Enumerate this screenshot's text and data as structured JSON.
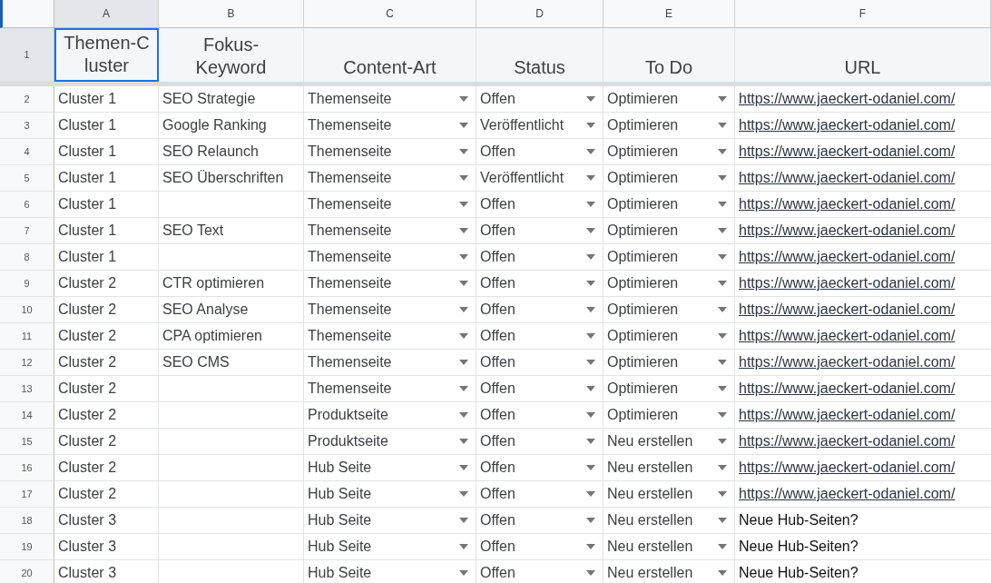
{
  "columns": [
    {
      "letter": "A",
      "selected": true
    },
    {
      "letter": "B",
      "selected": false
    },
    {
      "letter": "C",
      "selected": false
    },
    {
      "letter": "D",
      "selected": false
    },
    {
      "letter": "E",
      "selected": false
    },
    {
      "letter": "F",
      "selected": false
    }
  ],
  "header_row": {
    "number": "1",
    "selected": true,
    "cells": [
      {
        "label": "Themen-C\nluster",
        "selected": true
      },
      {
        "label": "Fokus-\nKeyword",
        "selected": false
      },
      {
        "label": "Content-Art",
        "selected": false
      },
      {
        "label": "Status",
        "selected": false
      },
      {
        "label": "To Do",
        "selected": false
      },
      {
        "label": "URL",
        "selected": false
      }
    ]
  },
  "rows": [
    {
      "number": "2",
      "cluster": "Cluster 1",
      "keyword": "SEO Strategie",
      "content_type": "Themenseite",
      "status": "Offen",
      "todo": "Optimieren",
      "url": {
        "kind": "link",
        "text": "https://www.jaeckert-odaniel.com/"
      }
    },
    {
      "number": "3",
      "cluster": "Cluster 1",
      "keyword": "Google Ranking",
      "content_type": "Themenseite",
      "status": "Veröffentlicht",
      "todo": "Optimieren",
      "url": {
        "kind": "link",
        "text": "https://www.jaeckert-odaniel.com/"
      }
    },
    {
      "number": "4",
      "cluster": "Cluster 1",
      "keyword": "SEO Relaunch",
      "content_type": "Themenseite",
      "status": "Offen",
      "todo": "Optimieren",
      "url": {
        "kind": "link",
        "text": "https://www.jaeckert-odaniel.com/"
      }
    },
    {
      "number": "5",
      "cluster": "Cluster 1",
      "keyword": "SEO Überschriften",
      "content_type": "Themenseite",
      "status": "Veröffentlicht",
      "todo": "Optimieren",
      "url": {
        "kind": "link",
        "text": "https://www.jaeckert-odaniel.com/"
      }
    },
    {
      "number": "6",
      "cluster": "Cluster 1",
      "content_type": "Themenseite",
      "status": "Offen",
      "todo": "Optimieren",
      "url": {
        "kind": "link",
        "text": "https://www.jaeckert-odaniel.com/"
      }
    },
    {
      "number": "7",
      "cluster": "Cluster 1",
      "keyword": "SEO Text",
      "content_type": "Themenseite",
      "status": "Offen",
      "todo": "Optimieren",
      "url": {
        "kind": "link",
        "text": "https://www.jaeckert-odaniel.com/"
      }
    },
    {
      "number": "8",
      "cluster": "Cluster 1",
      "content_type": "Themenseite",
      "status": "Offen",
      "todo": "Optimieren",
      "url": {
        "kind": "link",
        "text": "https://www.jaeckert-odaniel.com/"
      }
    },
    {
      "number": "9",
      "cluster": "Cluster 2",
      "keyword": "CTR optimieren",
      "content_type": "Themenseite",
      "status": "Offen",
      "todo": "Optimieren",
      "url": {
        "kind": "link",
        "text": "https://www.jaeckert-odaniel.com/"
      }
    },
    {
      "number": "10",
      "cluster": "Cluster 2",
      "keyword": "SEO Analyse",
      "content_type": "Themenseite",
      "status": "Offen",
      "todo": "Optimieren",
      "url": {
        "kind": "link",
        "text": "https://www.jaeckert-odaniel.com/"
      }
    },
    {
      "number": "11",
      "cluster": "Cluster 2",
      "keyword": "CPA optimieren",
      "content_type": "Themenseite",
      "status": "Offen",
      "todo": "Optimieren",
      "url": {
        "kind": "link",
        "text": "https://www.jaeckert-odaniel.com/"
      }
    },
    {
      "number": "12",
      "cluster": "Cluster 2",
      "keyword": "SEO CMS",
      "content_type": "Themenseite",
      "status": "Offen",
      "todo": "Optimieren",
      "url": {
        "kind": "link",
        "text": "https://www.jaeckert-odaniel.com/"
      }
    },
    {
      "number": "13",
      "cluster": "Cluster 2",
      "content_type": "Themenseite",
      "status": "Offen",
      "todo": "Optimieren",
      "url": {
        "kind": "link",
        "text": "https://www.jaeckert-odaniel.com/"
      }
    },
    {
      "number": "14",
      "cluster": "Cluster 2",
      "content_type": "Produktseite",
      "status": "Offen",
      "todo": "Optimieren",
      "url": {
        "kind": "link",
        "text": "https://www.jaeckert-odaniel.com/"
      }
    },
    {
      "number": "15",
      "cluster": "Cluster 2",
      "content_type": "Produktseite",
      "status": "Offen",
      "todo": "Neu erstellen",
      "url": {
        "kind": "link",
        "text": "https://www.jaeckert-odaniel.com/"
      }
    },
    {
      "number": "16",
      "cluster": "Cluster 2",
      "content_type": "Hub Seite",
      "status": "Offen",
      "todo": "Neu erstellen",
      "url": {
        "kind": "link",
        "text": "https://www.jaeckert-odaniel.com/"
      }
    },
    {
      "number": "17",
      "cluster": "Cluster 2",
      "content_type": "Hub Seite",
      "status": "Offen",
      "todo": "Neu erstellen",
      "url": {
        "kind": "link",
        "text": "https://www.jaeckert-odaniel.com/"
      }
    },
    {
      "number": "18",
      "cluster": "Cluster 3",
      "content_type": "Hub Seite",
      "status": "Offen",
      "todo": "Neu erstellen",
      "url": {
        "kind": "text",
        "text": "Neue Hub-Seiten?"
      }
    },
    {
      "number": "19",
      "cluster": "Cluster 3",
      "content_type": "Hub Seite",
      "status": "Offen",
      "todo": "Neu erstellen",
      "url": {
        "kind": "text",
        "text": "Neue Hub-Seiten?"
      }
    },
    {
      "number": "20",
      "cluster": "Cluster 3",
      "content_type": "Hub Seite",
      "status": "Offen",
      "todo": "Neu erstellen",
      "url": {
        "kind": "text",
        "text": "Neue Hub-Seiten?"
      }
    }
  ]
}
